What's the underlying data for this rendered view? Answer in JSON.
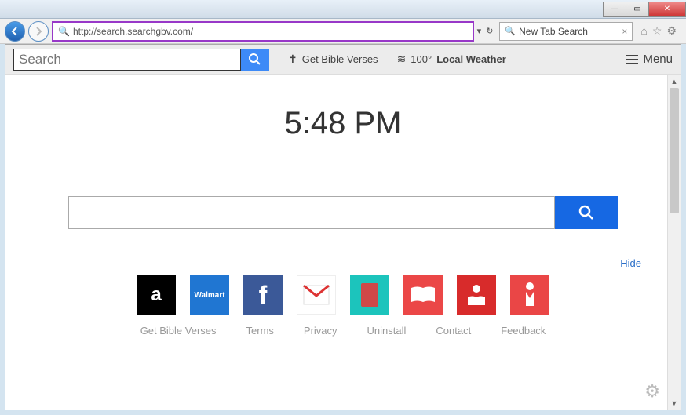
{
  "browser": {
    "url": "http://search.searchgbv.com/",
    "tab_title": "New Tab Search"
  },
  "toolbar": {
    "search_placeholder": "Search",
    "bible_link": "Get Bible Verses",
    "weather_temp": "100°",
    "weather_label": "Local Weather",
    "menu_label": "Menu"
  },
  "page": {
    "clock": "5:48 PM",
    "hide_label": "Hide",
    "tiles": {
      "amazon": "a",
      "walmart": "Walmart",
      "fb": "f"
    }
  },
  "footer": {
    "links": [
      "Get Bible Verses",
      "Terms",
      "Privacy",
      "Uninstall",
      "Contact",
      "Feedback"
    ]
  }
}
